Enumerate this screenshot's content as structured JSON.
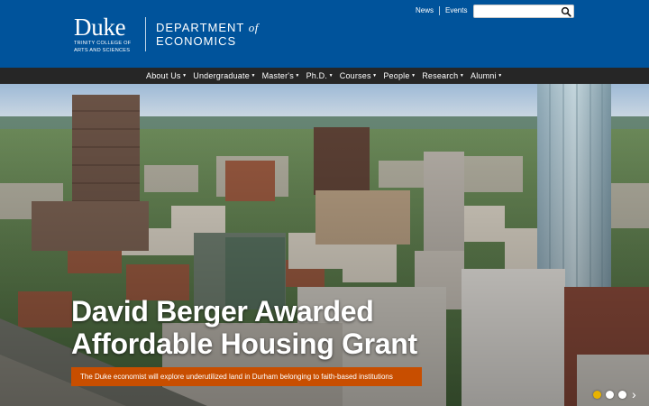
{
  "brand": {
    "logo_word": "Duke",
    "logo_sub_line1": "TRINITY COLLEGE OF",
    "logo_sub_line2": "ARTS AND SCIENCES",
    "dept_line1": "DEPARTMENT",
    "dept_of": "of",
    "dept_line2": "ECONOMICS"
  },
  "utility": {
    "links": [
      "News",
      "Events"
    ],
    "search_value": ""
  },
  "nav": {
    "items": [
      "About Us",
      "Undergraduate",
      "Master's",
      "Ph.D.",
      "Courses",
      "People",
      "Research",
      "Alumni"
    ]
  },
  "hero": {
    "title_line1": "David Berger Awarded",
    "title_line2": "Affordable Housing Grant",
    "caption": "The Duke economist will explore underutilized land in Durham belonging to faith-based institutions",
    "slide_count": 3,
    "active_slide": 1
  },
  "colors": {
    "header_blue": "#00539b",
    "nav_bg": "#262626",
    "caption_orange": "#c84e00",
    "active_dot": "#e8b300"
  },
  "icons": {
    "search": "magnifier-icon",
    "caret": "caret-down-icon",
    "next": "chevron-right-icon"
  }
}
